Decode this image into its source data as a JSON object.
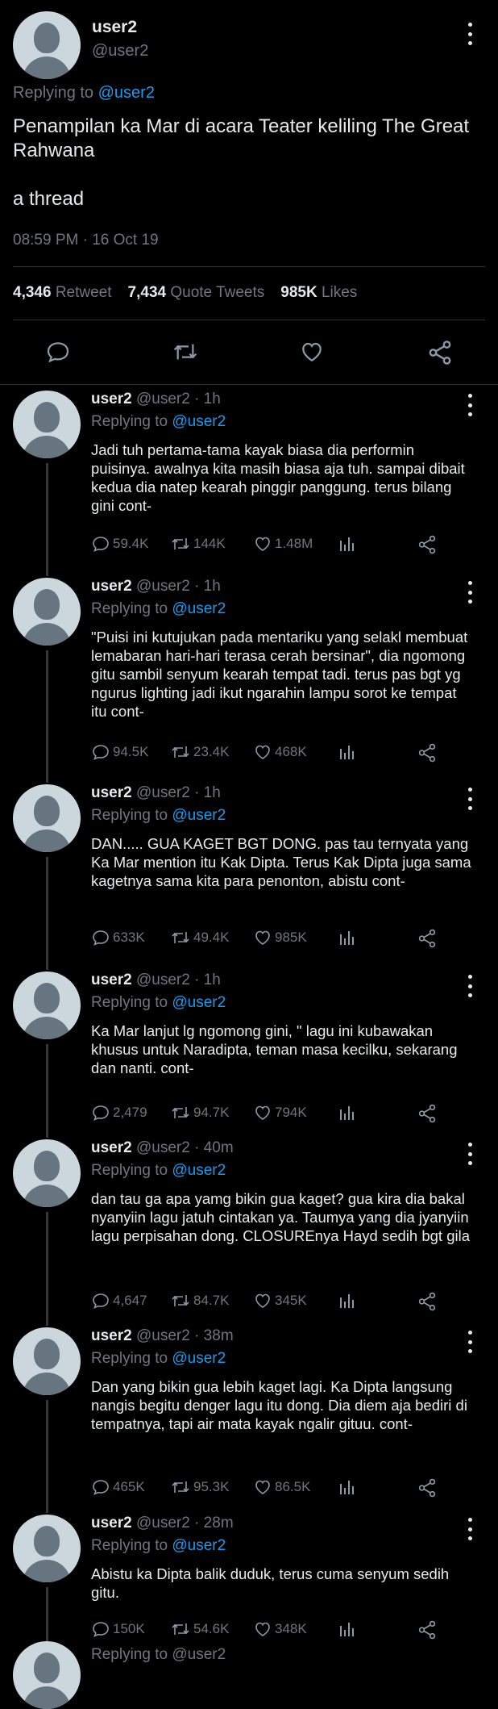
{
  "main": {
    "name": "user2",
    "handle": "@user2",
    "replying_prefix": "Replying to",
    "replying_handle": "@user2",
    "text": "Penampilan  ka Mar di acara Teater keliling The Great Rahwana\n\na thread",
    "time": "08:59 PM · 16 Oct 19",
    "retweets": "4,346",
    "retweets_label": "Retweet",
    "quotes": "7,434",
    "quotes_label": "Quote Tweets",
    "likes": "985K",
    "likes_label": "Likes"
  },
  "replies": [
    {
      "name": "user2",
      "meta": "@user2 · 1h",
      "replying_prefix": "Replying to",
      "replying_handle": "@user2",
      "text": "Jadi tuh pertama-tama kayak biasa dia performin puisinya.  awalnya kita masih biasa aja tuh.  sampai dibait kedua dia natep kearah pinggir panggung.  terus bilang gini cont-",
      "replies": "59.4K",
      "retweets": "144K",
      "likes": "1.48M"
    },
    {
      "name": "user2",
      "meta": "@user2 · 1h",
      "replying_prefix": "Replying to",
      "replying_handle": "@user2",
      "text": "\"Puisi ini kutujukan pada mentariku yang selakl membuat lemabaran hari-hari terasa cerah bersinar\", dia ngomong gitu sambil senyum kearah tempat tadi.  terus pas bgt yg ngurus lighting jadi ikut ngarahin lampu sorot ke tempat itu cont-",
      "replies": "94.5K",
      "retweets": "23.4K",
      "likes": "468K"
    },
    {
      "name": "user2",
      "meta": "@user2 · 1h",
      "replying_prefix": "Replying to",
      "replying_handle": "@user2",
      "text": "DAN..... GUA KAGET BGT DONG.  pas tau ternyata yang Ka Mar mention itu Kak Dipta.  Terus Kak  Dipta juga sama kagetnya sama kita para penonton, abistu cont-",
      "replies": "633K",
      "retweets": "49.4K",
      "likes": "985K"
    },
    {
      "name": "user2",
      "meta": "@user2 · 1h",
      "replying_prefix": "Replying to",
      "replying_handle": "@user2",
      "text": "Ka Mar lanjut lg ngomong gini, \" lagu ini kubawakan khusus untuk Naradipta, teman masa kecilku, sekarang dan nanti.  cont-",
      "replies": "2,479",
      "retweets": "94.7K",
      "likes": "794K"
    },
    {
      "name": "user2",
      "meta": "@user2 · 40m",
      "replying_prefix": "Replying to",
      "replying_handle": "@user2",
      "text": "dan tau ga apa yamg bikin gua kaget? gua kira dia bakal nyanyiin lagu jatuh cintakan ya.  Taumya yang dia jyanyiin lagu perpisahan dong.  CLOSUREnya Hayd sedih bgt gila",
      "replies": "4,647",
      "retweets": "84.7K",
      "likes": "345K"
    },
    {
      "name": "user2",
      "meta": "@user2 · 38m",
      "replying_prefix": "Replying to",
      "replying_handle": "@user2",
      "text": "Dan yang bikin gua lebih kaget lagi.  Ka Dipta langsung nangis begitu denger lagu itu dong.  Dia diem aja bediri di tempatnya, tapi air mata kayak ngalir gituu.  cont-",
      "replies": "465K",
      "retweets": "95.3K",
      "likes": "86.5K"
    },
    {
      "name": "user2",
      "meta": "@user2 · 28m",
      "replying_prefix": "Replying to",
      "replying_handle": "@user2",
      "text": "Abistu ka Dipta balik duduk, terus cuma senyum sedih gitu.",
      "replies": "150K",
      "retweets": "54.6K",
      "likes": "348K"
    }
  ],
  "footer_peek": "Replying to @user2",
  "colors": {
    "background": "#000000",
    "text": "#e7e9ea",
    "muted": "#71767b",
    "link": "#1d9bf0",
    "divider": "#2f3336"
  }
}
